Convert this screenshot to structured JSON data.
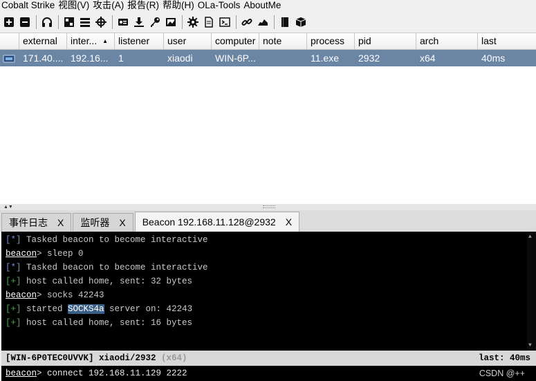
{
  "menubar": {
    "items": [
      "Cobalt Strike",
      "视图(V)",
      "攻击(A)",
      "报告(R)",
      "帮助(H)",
      "OLa-Tools",
      "AboutMe"
    ]
  },
  "toolbar": {
    "icons": [
      "plus-icon",
      "minus-icon",
      "headphones-icon",
      "pivot-graph-icon",
      "session-list-icon",
      "target-icon",
      "credentials-icon",
      "download-icon",
      "key-icon",
      "screenshot-icon",
      "settings-gear-icon",
      "document-icon",
      "console-icon",
      "link-icon",
      "cloud-icon",
      "book-icon",
      "package-icon"
    ]
  },
  "sessions": {
    "columns": [
      "",
      "external",
      "inter...",
      "listener",
      "user",
      "computer",
      "note",
      "process",
      "pid",
      "arch",
      "last"
    ],
    "rows": [
      {
        "external": "171.40....",
        "internal": "192.16...",
        "listener": "1",
        "user": "xiaodi",
        "computer": "WIN-6P...",
        "note": "",
        "process": "11.exe",
        "pid": "2932",
        "arch": "x64",
        "last": "40ms"
      }
    ]
  },
  "tabs": [
    {
      "label": "事件日志",
      "close": "X"
    },
    {
      "label": "监听器",
      "close": "X"
    },
    {
      "label": "Beacon 192.168.11.128@2932",
      "close": "X"
    }
  ],
  "console": {
    "lines": [
      {
        "kind": "info",
        "marker": "[*]",
        "text": " Tasked beacon to become interactive"
      },
      {
        "kind": "cmd",
        "prompt": "beacon",
        "text": "> sleep 0"
      },
      {
        "kind": "info",
        "marker": "[*]",
        "text": " Tasked beacon to become interactive"
      },
      {
        "kind": "ok",
        "marker": "[+]",
        "text": " host called home, sent: 32 bytes"
      },
      {
        "kind": "cmd",
        "prompt": "beacon",
        "text": "> socks 42243"
      },
      {
        "kind": "ok-hl",
        "marker": "[+]",
        "pre": " started ",
        "hl": "SOCKS4a",
        "post": " server on: 42243"
      },
      {
        "kind": "ok",
        "marker": "[+]",
        "text": " host called home, sent: 16 bytes"
      }
    ]
  },
  "status": {
    "host": "[WIN-6P0TEC0UVVK]",
    "user_pid": " xiaodi/2932",
    "arch": " (x64)",
    "last": "last: 40ms"
  },
  "input": {
    "prompt": "beacon",
    "value": "> connect 192.168.11.129 2222"
  },
  "watermark": "CSDN @++"
}
